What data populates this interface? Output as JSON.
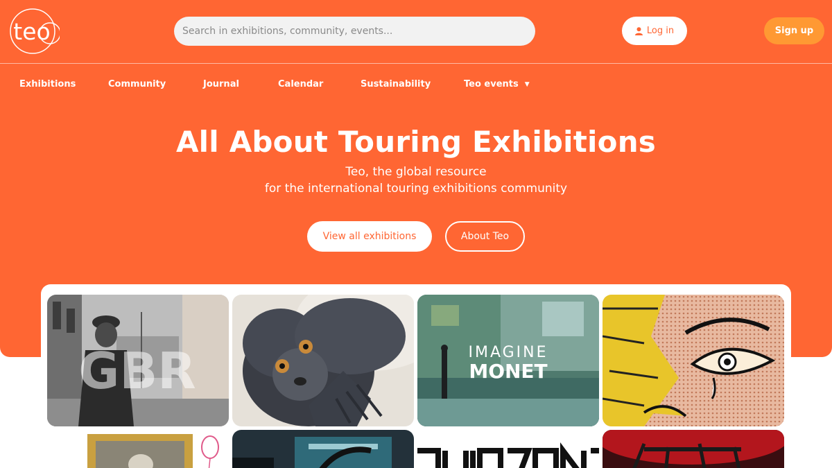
{
  "header": {
    "logo_text": "teo",
    "search_placeholder": "Search in exhibitions, community, events...",
    "login_label": "Log in",
    "signup_label": "Sign up"
  },
  "nav": {
    "items": [
      "Exhibitions",
      "Community",
      "Journal",
      "Calendar",
      "Sustainability",
      "Teo events"
    ]
  },
  "hero": {
    "title": "All About Touring Exhibitions",
    "subtitle_line1": "Teo, the global resource",
    "subtitle_line2": "for the international touring exhibitions community",
    "primary_button": "View all exhibitions",
    "secondary_button": "About Teo"
  },
  "gallery": {
    "tiles": [
      {
        "overlay_text": "GBR"
      },
      {
        "overlay_text": ""
      },
      {
        "overlay_text_1": "IMAGINE",
        "overlay_text_2": "MONET"
      },
      {
        "overlay_text": ""
      }
    ]
  },
  "colors": {
    "brand": "#ff6633",
    "signup": "#ff9933",
    "white": "#ffffff"
  },
  "icons": {
    "login": "user-icon",
    "dropdown": "chevron-down-icon"
  }
}
